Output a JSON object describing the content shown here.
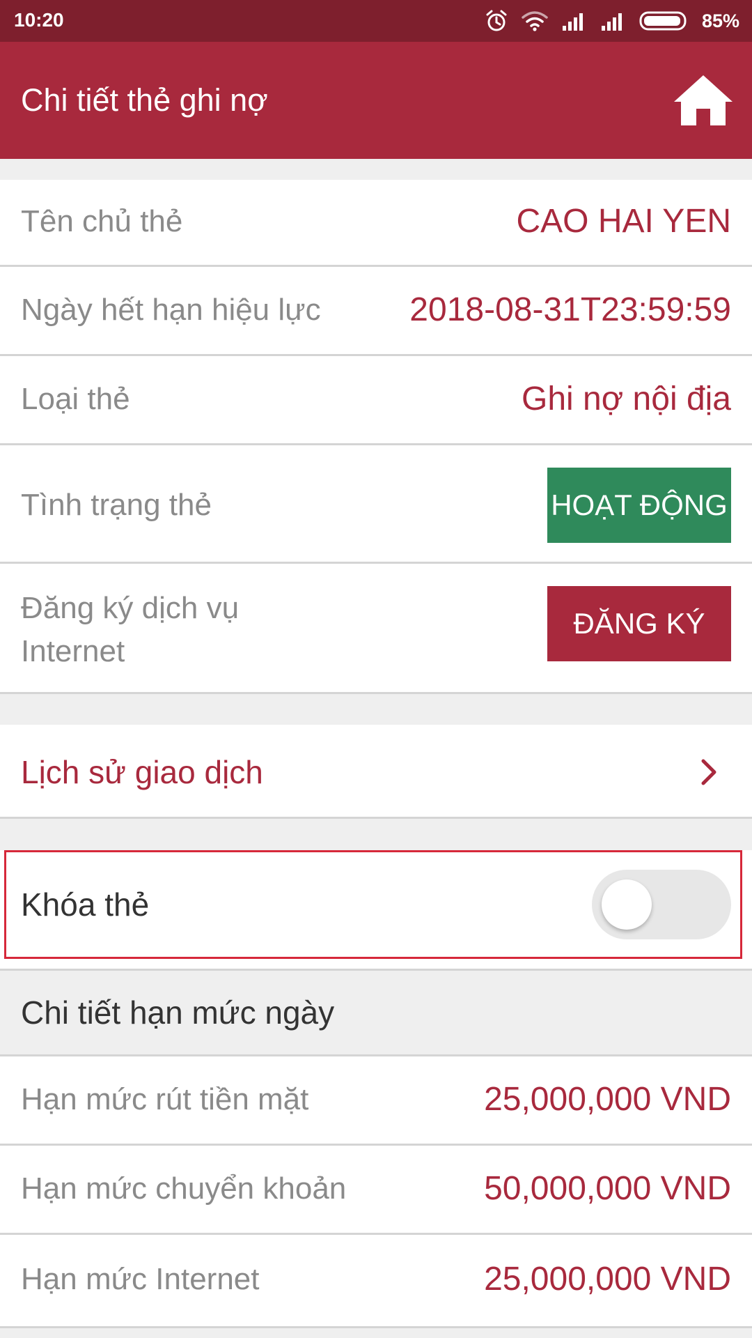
{
  "status_bar": {
    "time": "10:20",
    "battery": "85%",
    "icons": [
      "alarm-icon",
      "wifi-icon",
      "signal-icon",
      "signal-icon",
      "battery-icon"
    ]
  },
  "header": {
    "title": "Chi tiết thẻ ghi nợ",
    "home_icon": "home-icon"
  },
  "card_details": {
    "holder_label": "Tên chủ thẻ",
    "holder_value": "CAO HAI YEN",
    "expiry_label": "Ngày hết hạn hiệu lực",
    "expiry_value": "2018-08-31T23:59:59",
    "type_label": "Loại thẻ",
    "type_value": "Ghi nợ nội địa",
    "status_label": "Tình trạng thẻ",
    "status_value": "HOẠT ĐỘNG",
    "internet_label_line1": "Đăng ký dịch vụ",
    "internet_label_line2": "Internet",
    "register_button": "ĐĂNG KÝ"
  },
  "history": {
    "label": "Lịch sử giao dịch"
  },
  "lock": {
    "label": "Khóa thẻ",
    "enabled": false
  },
  "limits": {
    "title": "Chi tiết hạn mức ngày",
    "items": [
      {
        "label": "Hạn mức rút tiền mặt",
        "value": "25,000,000 VND"
      },
      {
        "label": "Hạn mức chuyển khoản",
        "value": "50,000,000 VND"
      },
      {
        "label": "Hạn mức Internet",
        "value": "25,000,000 VND"
      }
    ]
  },
  "colors": {
    "primary": "#a8293d",
    "status_bar": "#7e1f2d",
    "active": "#2f8a5b",
    "highlight": "#d6283a"
  }
}
